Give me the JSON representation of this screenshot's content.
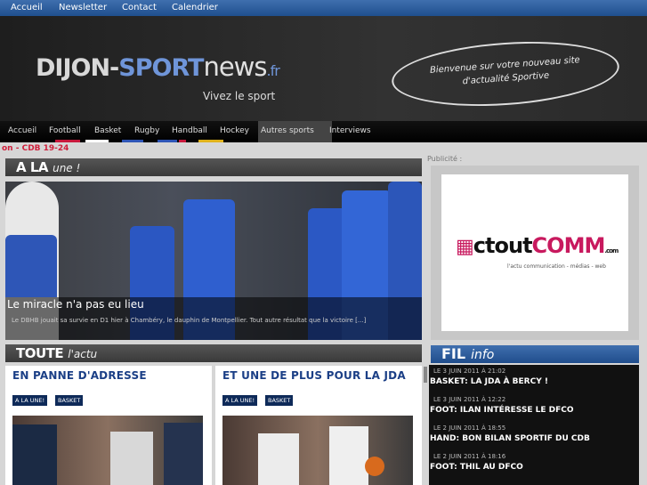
{
  "topnav": [
    "Accueil",
    "Newsletter",
    "Contact",
    "Calendrier"
  ],
  "header": {
    "logo_part1": "DIJON-",
    "logo_part2": "SPORT",
    "logo_part3": "news",
    "logo_part4": ".fr",
    "tagline": "Vivez le sport",
    "welcome_line1": "Bienvenue sur votre nouveau site",
    "welcome_line2": "d'actualité Sportive"
  },
  "mainnav": {
    "items": [
      "Accueil",
      "Football",
      "Basket",
      "Rugby",
      "Handball",
      "Hockey",
      "Autres sports",
      "Interviews"
    ],
    "active": "Autres sports",
    "colors": [
      "",
      "#c8193c",
      "#ffffff",
      "#2e55b6",
      "#2e55b6",
      "#e0b21b",
      "",
      ""
    ]
  },
  "ticker": "on - CDB 19-24",
  "une": {
    "head_bold": "A LA",
    "head_italic": "une !",
    "title": "Le miracle n'a pas eu lieu",
    "text": "Le DBHB jouait sa survie en D1 hier à Chambéry, le dauphin de Montpellier. Tout autre résultat que la victoire [...]"
  },
  "actu": {
    "head_bold": "TOUTE",
    "head_italic": "l'actu",
    "articles": [
      {
        "title": "EN PANNE D'ADRESSE",
        "tags": [
          "A LA UNE!",
          "BASKET"
        ]
      },
      {
        "title": "ET UNE DE PLUS POUR LA JDA",
        "tags": [
          "A LA UNE!",
          "BASKET"
        ]
      }
    ]
  },
  "sidebar": {
    "pub_label": "Publicité :",
    "pub_logo1": "ctout",
    "pub_logo2": "COMM",
    "pub_logo3": ".com",
    "pub_sub": "l'actu communication - médias - web",
    "fil_bold": "FIL",
    "fil_italic": "info",
    "fil": [
      {
        "date": "LE 3 JUIN 2011 À 21:02",
        "title": "BASKET: LA JDA À BERCY !"
      },
      {
        "date": "LE 3 JUIN 2011 À 12:22",
        "title": "FOOT: ILAN INTÉRESSE LE DFCO"
      },
      {
        "date": "LE 2 JUIN 2011 À 18:55",
        "title": "HAND: BON BILAN SPORTIF DU CDB"
      },
      {
        "date": "LE 2 JUIN 2011 À 18:16",
        "title": "FOOT: THIL AU DFCO"
      }
    ]
  }
}
